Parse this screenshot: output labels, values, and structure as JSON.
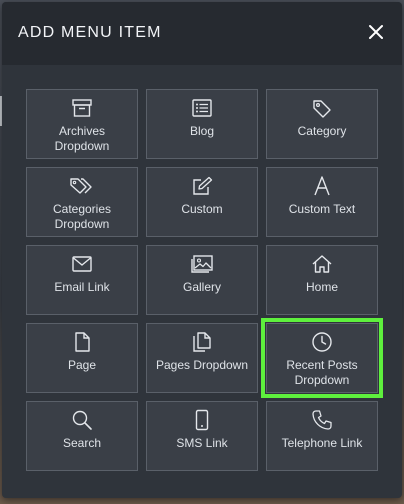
{
  "dialog": {
    "title": "ADD MENU ITEM",
    "close_icon": "close-icon"
  },
  "tiles": [
    {
      "label": "Archives\nDropdown",
      "icon": "archive-box-icon"
    },
    {
      "label": "Blog",
      "icon": "list-icon"
    },
    {
      "label": "Category",
      "icon": "tag-icon"
    },
    {
      "label": "Categories\nDropdown",
      "icon": "tags-icon"
    },
    {
      "label": "Custom",
      "icon": "edit-square-icon"
    },
    {
      "label": "Custom Text",
      "icon": "letter-a-icon"
    },
    {
      "label": "Email Link",
      "icon": "envelope-icon"
    },
    {
      "label": "Gallery",
      "icon": "images-icon"
    },
    {
      "label": "Home",
      "icon": "home-icon"
    },
    {
      "label": "Page",
      "icon": "document-icon"
    },
    {
      "label": "Pages Dropdown",
      "icon": "copy-documents-icon"
    },
    {
      "label": "Recent Posts\nDropdown",
      "icon": "clock-icon",
      "selected": true
    },
    {
      "label": "Search",
      "icon": "search-icon"
    },
    {
      "label": "SMS Link",
      "icon": "mobile-phone-icon"
    },
    {
      "label": "Telephone Link",
      "icon": "phone-icon"
    }
  ],
  "colors": {
    "modal_bg": "#2f343b",
    "header_bg": "#262a30",
    "tile_bg": "#3a3f47",
    "tile_border": "#5a6069",
    "selected_outline": "#5ef03d"
  }
}
